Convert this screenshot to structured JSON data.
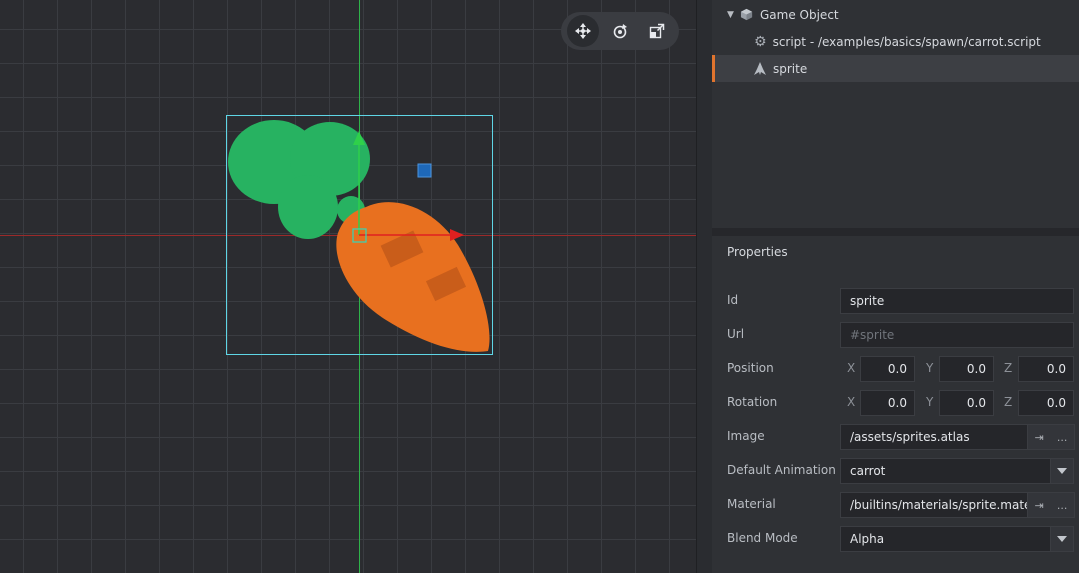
{
  "outline": {
    "items": [
      {
        "label": "Game Object",
        "icon": "cube-icon",
        "expanded": true
      },
      {
        "label": "script - /examples/basics/spawn/carrot.script",
        "icon": "gear-icon"
      },
      {
        "label": "sprite",
        "icon": "sprite-icon",
        "selected": true
      }
    ]
  },
  "properties": {
    "title": "Properties",
    "id": {
      "label": "Id",
      "value": "sprite"
    },
    "url": {
      "label": "Url",
      "placeholder": "#sprite"
    },
    "position": {
      "label": "Position",
      "x": "0.0",
      "y": "0.0",
      "z": "0.0"
    },
    "rotation": {
      "label": "Rotation",
      "x": "0.0",
      "y": "0.0",
      "z": "0.0"
    },
    "axis_letters": {
      "x": "X",
      "y": "Y",
      "z": "Z"
    },
    "image": {
      "label": "Image",
      "value": "/assets/sprites.atlas"
    },
    "default_animation": {
      "label": "Default Animation",
      "value": "carrot"
    },
    "material": {
      "label": "Material",
      "value": "/builtins/materials/sprite.material"
    },
    "blend_mode": {
      "label": "Blend Mode",
      "value": "Alpha"
    },
    "more_label": "..."
  },
  "colors": {
    "accent": "#e0742e",
    "selection_box": "#5fd6e6",
    "x_axis": "#e02020",
    "y_axis": "#2fd04a",
    "carrot_top": "#27b261",
    "carrot_body": "#e8701f"
  }
}
